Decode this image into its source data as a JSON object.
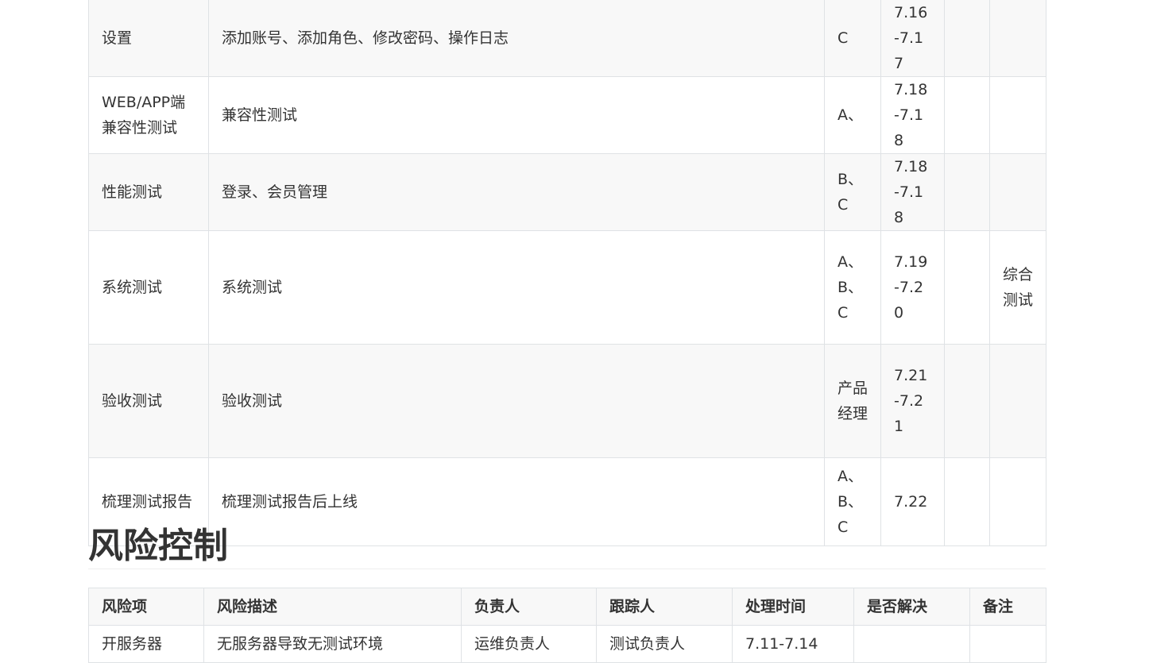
{
  "schedule_rows": [
    {
      "module": "设置",
      "content": "添加账号、添加角色、修改密码、操作日志",
      "owner": "C",
      "time": "7.16-7.17",
      "status": "",
      "note": ""
    },
    {
      "module": "WEB/APP端兼容性测试",
      "content": "兼容性测试",
      "owner": "A、",
      "time": "7.18-7.18",
      "status": "",
      "note": ""
    },
    {
      "module": "性能测试",
      "content": "登录、会员管理",
      "owner": "B、C",
      "time": "7.18-7.18",
      "status": "",
      "note": ""
    },
    {
      "module": "系统测试",
      "content": "系统测试",
      "owner": "A、B、C",
      "time": "7.19-7.20",
      "status": "",
      "note": "综合测试"
    },
    {
      "module": "验收测试",
      "content": "验收测试",
      "owner": "产品经理",
      "time": "7.21-7.21",
      "status": "",
      "note": ""
    },
    {
      "module": "梳理测试报告",
      "content": "梳理测试报告后上线",
      "owner": "A、B、C",
      "time": "7.22",
      "status": "",
      "note": ""
    }
  ],
  "risk_section": {
    "heading": "风险控制",
    "headers": [
      "风险项",
      "风险描述",
      "负责人",
      "跟踪人",
      "处理时间",
      "是否解决",
      "备注"
    ],
    "rows": [
      {
        "item": "开服务器",
        "desc": "无服务器导致无测试环境",
        "owner": "运维负责人",
        "tracker": "测试负责人",
        "time": "7.11-7.14",
        "resolved": "",
        "note": ""
      }
    ]
  }
}
